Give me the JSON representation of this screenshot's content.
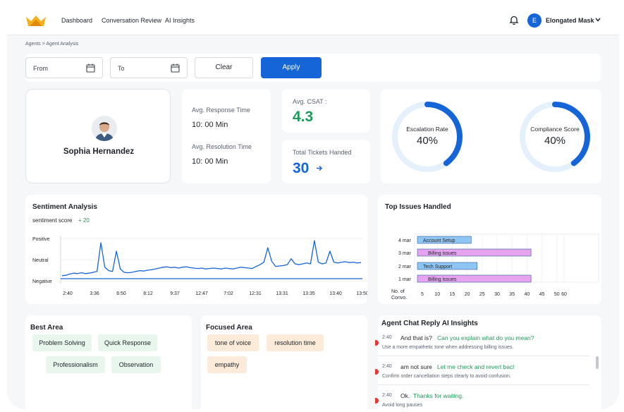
{
  "nav": {
    "items": [
      "Dashboard",
      "Conversation Review",
      "AI Insights"
    ],
    "user_initial": "E",
    "user_name": "Elongated Mask"
  },
  "breadcrumb": "Agents > Agent Analysis",
  "filters": {
    "from_label": "From",
    "to_label": "To",
    "clear_label": "Clear",
    "apply_label": "Apply"
  },
  "agent": {
    "name": "Sophia Hernandez"
  },
  "stats": {
    "avg_response_label": "Avg. Response Time",
    "avg_response_value": "10: 00 Min",
    "avg_resolution_label": "Avg. Resolution Time",
    "avg_resolution_value": "10: 00 Min",
    "csat_label": "Avg. CSAT :",
    "csat_value": "4.3",
    "tickets_label": "Total Tickets Handed",
    "tickets_value": "30"
  },
  "gauges": [
    {
      "label": "Escalation Rate",
      "value": "40%",
      "fraction": 0.4
    },
    {
      "label": "Compliance Score",
      "value": "40%",
      "fraction": 0.4
    }
  ],
  "sentiment": {
    "title": "Sentiment Analysis",
    "score_label": "sentiment score",
    "score_value": "+ 20"
  },
  "issues": {
    "title": "Top Issues Handled"
  },
  "chart_data": [
    {
      "type": "line",
      "title": "Sentiment Analysis",
      "y_categories": [
        "Positive",
        "Neutral",
        "Negative"
      ],
      "x_ticks": [
        "2:40",
        "3:36",
        "6:50",
        "8:12",
        "9:37",
        "12:47",
        "7:02",
        "12:31",
        "13:31",
        "13:35",
        "13:40",
        "13:50"
      ],
      "series": [
        {
          "values": [
            0.12,
            0.13,
            0.16,
            0.18,
            0.17,
            0.19,
            0.17,
            0.18,
            0.2,
            0.22,
            0.9,
            0.32,
            0.24,
            0.22,
            0.7,
            0.28,
            0.2,
            0.19,
            0.2,
            0.22,
            0.24,
            0.23,
            0.25,
            0.26,
            0.28,
            0.3,
            0.32,
            0.33,
            0.31,
            0.32,
            0.3,
            0.32,
            0.33,
            0.31,
            0.3,
            0.29,
            0.3,
            0.28,
            0.29,
            0.3,
            0.29,
            0.28,
            0.3,
            0.29,
            0.28,
            0.3,
            0.32,
            0.31,
            0.3,
            0.29,
            0.34,
            0.38,
            0.44,
            0.78,
            0.46,
            0.34,
            0.35,
            0.36,
            0.38,
            0.52,
            0.4,
            0.38,
            0.4,
            0.42,
            0.4,
            0.95,
            0.44,
            0.4,
            0.42,
            0.7,
            0.44,
            0.42,
            0.44,
            0.45,
            0.43,
            0.44,
            0.42,
            0.43
          ]
        }
      ],
      "flat_line": 0.05
    },
    {
      "type": "bar",
      "title": "Top Issues Handled",
      "xlabel": "No. of Convo.",
      "x_ticks": [
        5,
        10,
        15,
        20,
        25,
        30,
        35,
        40,
        45,
        50,
        60
      ],
      "rows": [
        {
          "date": "4 mar",
          "label": "Account Setup",
          "start": 5,
          "end": 23,
          "color": "#8ec5f2"
        },
        {
          "date": "3 mar",
          "label": "Billing issues",
          "start": 5,
          "end": 43,
          "color": "#e6a3f0"
        },
        {
          "date": "2 mar",
          "label": "Tech Support",
          "start": 5,
          "end": 25,
          "color": "#8ec5f2"
        },
        {
          "date": "1 mar",
          "label": "Billing issues",
          "start": 5,
          "end": 43,
          "color": "#e6a3f0"
        }
      ]
    }
  ],
  "best_area": {
    "title": "Best Area",
    "chips": [
      "Problem Solving",
      "Quick Response",
      "Professionalism",
      "Observation"
    ]
  },
  "focused_area": {
    "title": "Focused Area",
    "chips": [
      "tone of voice",
      "resolution time",
      "empathy"
    ]
  },
  "insights": {
    "title": "Agent Chat Reply AI Insights",
    "items": [
      {
        "time": "2:40",
        "message": "And that is?",
        "reply": "Can you explain what do you mean?",
        "note": "Use a more empathetic tone when addressing billing issues."
      },
      {
        "time": "2:40",
        "message": "am not sure",
        "reply": "Let me check and revert bacl",
        "note": "Confirm order cancellation steps clearly to avoid confusion."
      },
      {
        "time": "2:40",
        "message": "Ok.",
        "reply": "Thanks for waiting.",
        "note": "Avoid long pauses"
      }
    ]
  },
  "colors": {
    "accent": "#1565d8",
    "positive": "#1e9a5a",
    "gauge_track": "#e4f1fc"
  }
}
